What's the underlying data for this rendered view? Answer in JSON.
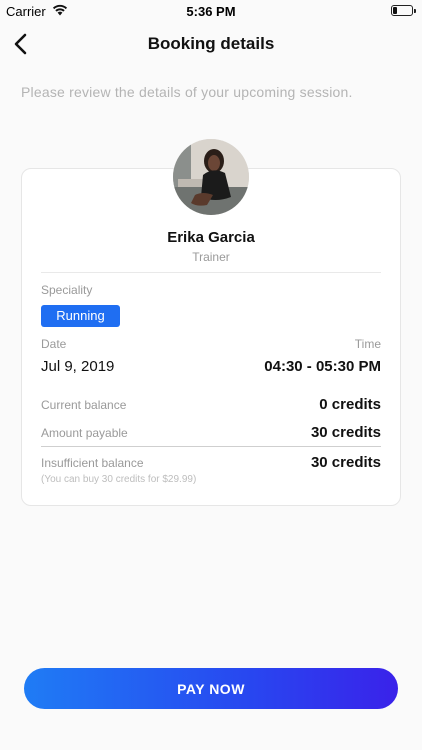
{
  "status_bar": {
    "carrier": "Carrier",
    "time": "5:36 PM",
    "battery_level": 0.2
  },
  "nav": {
    "title": "Booking details",
    "back_icon": "chevron-left-icon"
  },
  "subtitle": "Please review the details of your upcoming session.",
  "trainer": {
    "name": "Erika Garcia",
    "role": "Trainer"
  },
  "speciality": {
    "label": "Speciality",
    "tag": "Running"
  },
  "schedule": {
    "date_label": "Date",
    "date": "Jul 9, 2019",
    "time_label": "Time",
    "time": "04:30 - 05:30 PM"
  },
  "balance": {
    "current_label": "Current balance",
    "current_value": "0 credits",
    "payable_label": "Amount payable",
    "payable_value": "30 credits",
    "insufficient_label": "Insufficient balance",
    "insufficient_value": "30 credits",
    "note": "(You can buy 30 credits for $29.99)"
  },
  "actions": {
    "pay_label": "PAY NOW"
  },
  "colors": {
    "accent": "#1f6ef2",
    "button_gradient_end": "#3a22ea"
  }
}
